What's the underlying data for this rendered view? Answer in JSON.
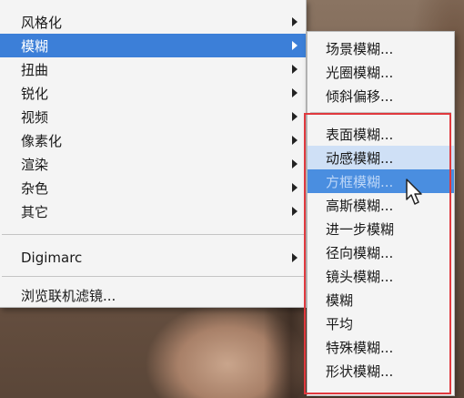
{
  "menu": {
    "items": [
      {
        "label": "风格化",
        "has_submenu": true,
        "active": false
      },
      {
        "label": "模糊",
        "has_submenu": true,
        "active": true
      },
      {
        "label": "扭曲",
        "has_submenu": true,
        "active": false
      },
      {
        "label": "锐化",
        "has_submenu": true,
        "active": false
      },
      {
        "label": "视频",
        "has_submenu": true,
        "active": false
      },
      {
        "label": "像素化",
        "has_submenu": true,
        "active": false
      },
      {
        "label": "渲染",
        "has_submenu": true,
        "active": false
      },
      {
        "label": "杂色",
        "has_submenu": true,
        "active": false
      },
      {
        "label": "其它",
        "has_submenu": true,
        "active": false
      }
    ],
    "digimarc": {
      "label": "Digimarc",
      "has_submenu": true
    },
    "browse": {
      "label": "浏览联机滤镜..."
    }
  },
  "submenu": {
    "group1": [
      "场景模糊...",
      "光圈模糊...",
      "倾斜偏移..."
    ],
    "group2": [
      "表面模糊...",
      "动感模糊...",
      "方框模糊...",
      "高斯模糊...",
      "进一步模糊",
      "径向模糊...",
      "镜头模糊...",
      "模糊",
      "平均",
      "特殊模糊...",
      "形状模糊..."
    ],
    "soft_hover_item": "动感模糊...",
    "active_item": "方框模糊..."
  },
  "colors": {
    "menu_bg": "#f4f4f4",
    "active_bg": "#3c7fd8",
    "highlight_border": "#e0393e"
  },
  "icons": [
    "submenu-arrow-icon",
    "mouse-pointer-icon"
  ]
}
